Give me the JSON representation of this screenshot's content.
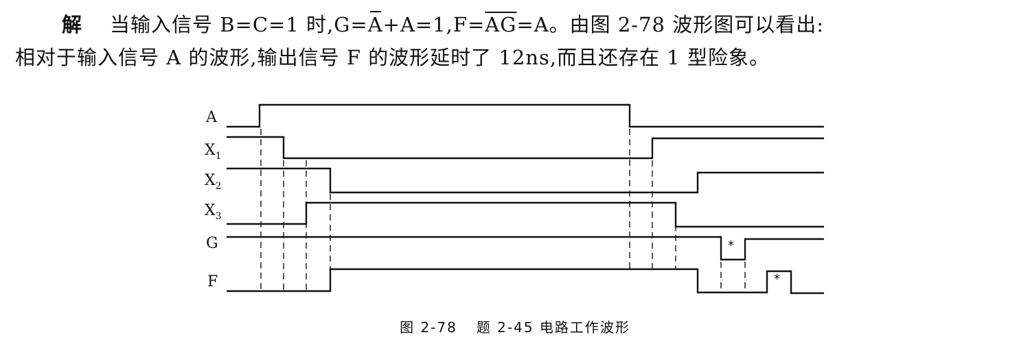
{
  "text": {
    "jie": "解",
    "line1_a": "当输入信号 B=C=1 时,G=",
    "line1_abar": "A",
    "line1_b": "+A=1,F=",
    "line1_agbar": "AG",
    "line1_c": "=A。由图 2-78 波形图可以看出:",
    "line2": "相对于输入信号 A 的波形,输出信号 F 的波形延时了 12ns,而且还存在 1 型险象。"
  },
  "caption": {
    "figure_no": "图 2-78",
    "title": "题 2-45 电路工作波形"
  },
  "signals": [
    {
      "name": "A",
      "label": "A",
      "sub": ""
    },
    {
      "name": "X1",
      "label": "X",
      "sub": "1"
    },
    {
      "name": "X2",
      "label": "X",
      "sub": "2"
    },
    {
      "name": "X3",
      "label": "X",
      "sub": "3"
    },
    {
      "name": "G",
      "label": "G",
      "sub": ""
    },
    {
      "name": "F",
      "label": "F",
      "sub": ""
    }
  ],
  "hazard_marker": "*"
}
